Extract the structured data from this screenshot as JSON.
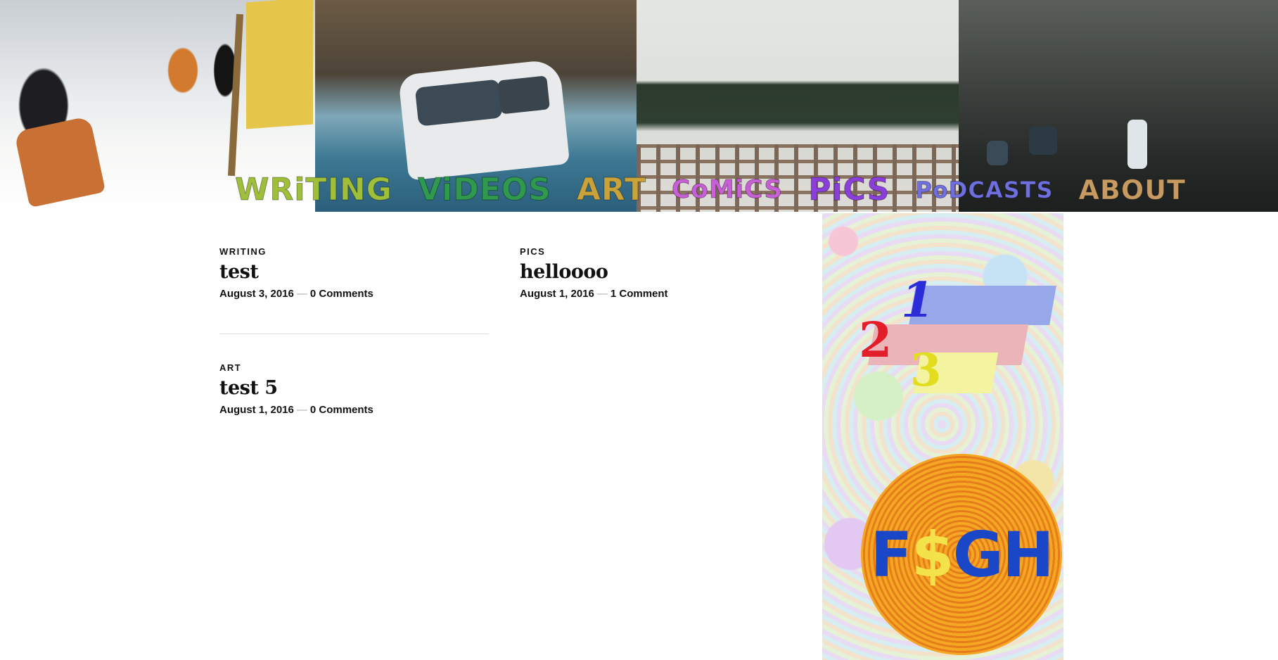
{
  "header": {
    "nav": [
      {
        "label": "WRiTING",
        "color": "#9fbf3a"
      },
      {
        "label": "ViDEOS",
        "color": "#2f9a4e"
      },
      {
        "label": "ART",
        "color": "#c9a23a"
      },
      {
        "label": "CoMiCS",
        "color": "#c95fd6"
      },
      {
        "label": "PiCS",
        "color": "#8b3fd9"
      },
      {
        "label": "PoDCASTS",
        "color": "#6f6fe0"
      },
      {
        "label": "ABOUT",
        "color": "#c79a62"
      }
    ]
  },
  "posts": [
    {
      "category": "WRITING",
      "title": "test",
      "date": "August 3, 2016",
      "comments": "0 Comments"
    },
    {
      "category": "PICS",
      "title": "helloooo",
      "date": "August 1, 2016",
      "comments": "1 Comment"
    },
    {
      "category": "ART",
      "title": "test 5",
      "date": "August 1, 2016",
      "comments": "0 Comments"
    }
  ],
  "meta_separator": "—",
  "sidebar": {
    "numbers": [
      "1",
      "2",
      "3"
    ],
    "logo_text": {
      "a": "F",
      "b": "$",
      "c": "GH"
    }
  },
  "colors": {
    "text": "#111111",
    "bar1": "#97a8ea",
    "bar2": "#eab4b8",
    "bar3": "#f4f3a0",
    "coin": "#f5a623",
    "logo": "#1a47c8"
  }
}
